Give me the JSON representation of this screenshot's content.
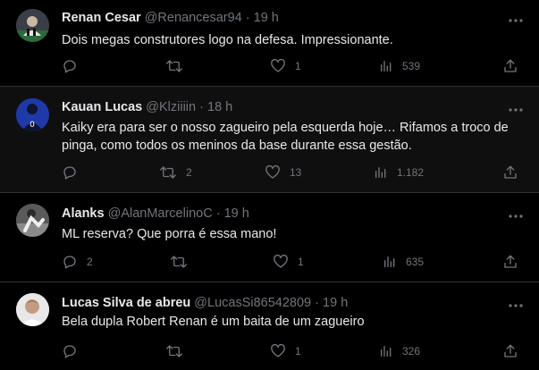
{
  "tweets": [
    {
      "name": "Renan Cesar",
      "handle": "@Renancesar94",
      "sep": "·",
      "time": "19 h",
      "text": "Dois megas construtores logo na defesa. Impressionante.",
      "replies": "",
      "retweets": "",
      "likes": "1",
      "views": "539"
    },
    {
      "name": "Kauan Lucas",
      "handle": "@Klziiiin",
      "sep": "·",
      "time": "18 h",
      "text": "Kaiky era para ser o nosso zagueiro pela esquerda hoje… Rifamos a troco de pinga, como todos os meninos da base durante essa gestão.",
      "replies": "",
      "retweets": "2",
      "likes": "13",
      "views": "1.182"
    },
    {
      "name": "Alanks",
      "handle": "@AlanMarcelinoC",
      "sep": "·",
      "time": "19 h",
      "text": "ML reserva? Que porra é essa mano!",
      "replies": "2",
      "retweets": "",
      "likes": "1",
      "views": "635"
    },
    {
      "name": "Lucas Silva de abreu",
      "handle": "@LucasSi86542809",
      "sep": "·",
      "time": "19 h",
      "text": "Bela dupla Robert Renan é um baita de um zagueiro",
      "replies": "",
      "retweets": "",
      "likes": "1",
      "views": "326"
    }
  ],
  "icons": {
    "reply": "reply-icon",
    "retweet": "retweet-icon",
    "like": "heart-icon",
    "views": "views-chart-icon",
    "share": "share-icon",
    "more": "more-icon"
  },
  "colors": {
    "background": "#000000",
    "highlight": "#0f0f10",
    "text": "#e7e9ea",
    "muted": "#71767b",
    "divider": "#2f3336"
  }
}
